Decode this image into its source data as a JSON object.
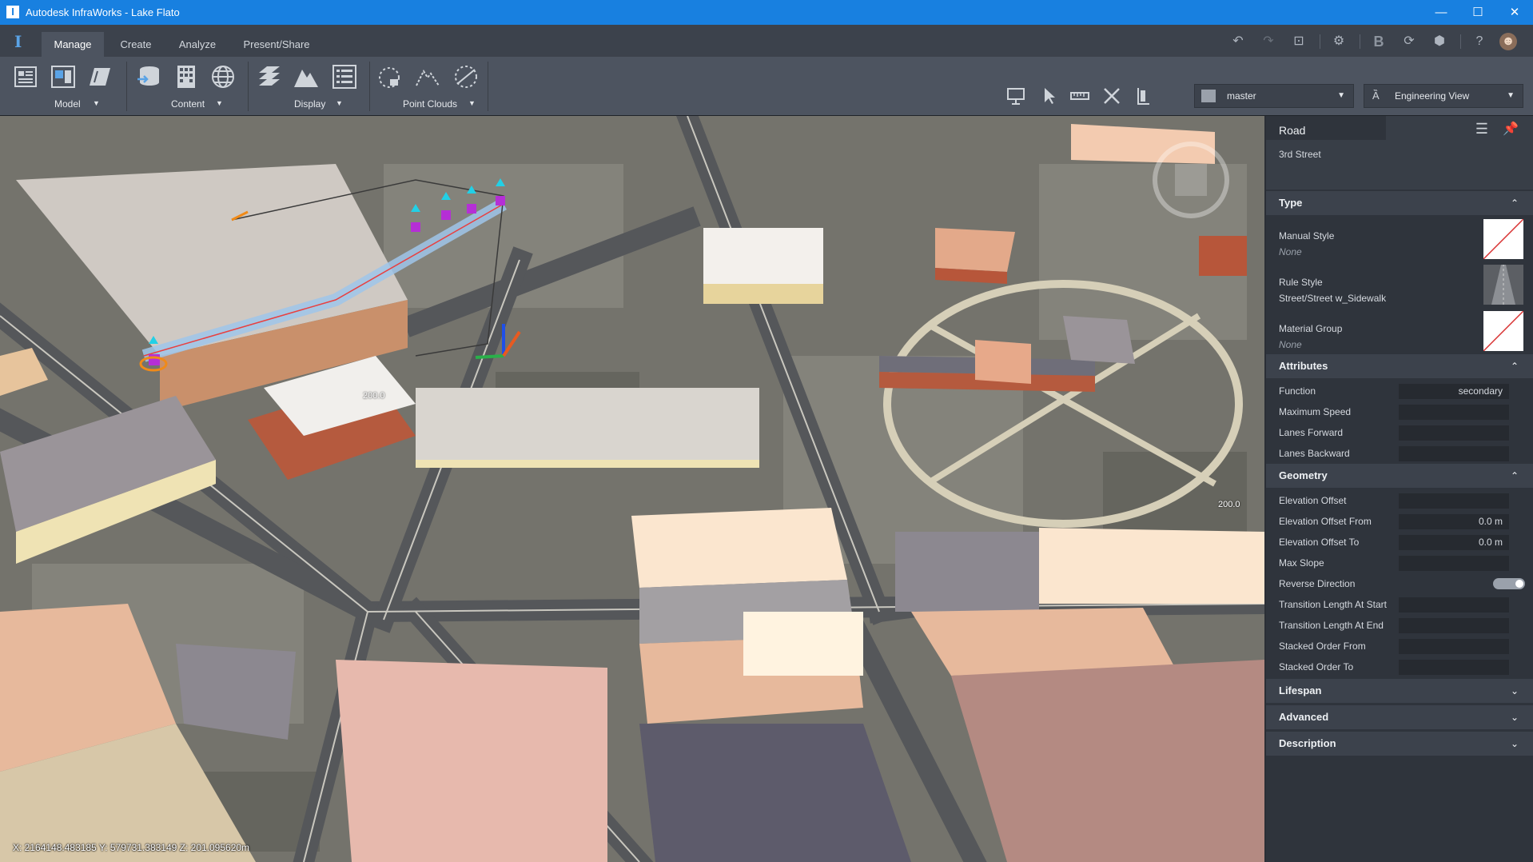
{
  "window": {
    "title": "Autodesk InfraWorks - Lake Flato",
    "app_icon": "I",
    "minimize": "—",
    "maximize": "☐",
    "close": "✕"
  },
  "tabs": [
    {
      "label": "Manage",
      "active": true
    },
    {
      "label": "Create",
      "active": false
    },
    {
      "label": "Analyze",
      "active": false
    },
    {
      "label": "Present/Share",
      "active": false
    }
  ],
  "ribbon": {
    "groups": [
      {
        "label": "Model",
        "caret": "▼"
      },
      {
        "label": "Content",
        "caret": "▼"
      },
      {
        "label": "Display",
        "caret": "▼"
      },
      {
        "label": "Point Clouds",
        "caret": "▼"
      }
    ],
    "proposal_dropdown": {
      "value": "master",
      "caret": "▼"
    },
    "view_dropdown": {
      "value": "Engineering View",
      "caret": "▼"
    }
  },
  "quick_access": {
    "account_label": "B"
  },
  "viewport": {
    "coords": "X: 2164148.483185 Y: 579731.383149 Z: 201.095620m",
    "dim_labels": [
      "200.0",
      "200.0"
    ]
  },
  "panel": {
    "type": "Road",
    "name": "3rd Street",
    "sections": {
      "type": {
        "title": "Type",
        "chevron": "⌃",
        "manual_style_label": "Manual Style",
        "manual_style_value": "None",
        "rule_style_label": "Rule Style",
        "rule_style_value": "Street/Street w_Sidewalk",
        "material_group_label": "Material Group",
        "material_group_value": "None"
      },
      "attributes": {
        "title": "Attributes",
        "chevron": "⌃",
        "rows": [
          {
            "label": "Function",
            "value": "secondary"
          },
          {
            "label": "Maximum Speed",
            "value": ""
          },
          {
            "label": "Lanes Forward",
            "value": ""
          },
          {
            "label": "Lanes Backward",
            "value": ""
          }
        ]
      },
      "geometry": {
        "title": "Geometry",
        "chevron": "⌃",
        "rows": [
          {
            "label": "Elevation Offset",
            "value": ""
          },
          {
            "label": "Elevation Offset From",
            "value": "0.0  m"
          },
          {
            "label": "Elevation Offset To",
            "value": "0.0  m"
          },
          {
            "label": "Max Slope",
            "value": ""
          },
          {
            "label": "Reverse Direction",
            "value": ""
          },
          {
            "label": "Transition Length At Start",
            "value": ""
          },
          {
            "label": "Transition Length At End",
            "value": ""
          },
          {
            "label": "Stacked Order From",
            "value": ""
          },
          {
            "label": "Stacked Order To",
            "value": ""
          }
        ]
      },
      "collapsed": [
        {
          "title": "Lifespan",
          "chevron": "⌄"
        },
        {
          "title": "Advanced",
          "chevron": "⌄"
        },
        {
          "title": "Description",
          "chevron": "⌄"
        }
      ]
    }
  },
  "colors": {
    "titlebar": "#1880e0",
    "tab_bar": "#3c424c",
    "ribbon": "#4d5460",
    "panel": "#2f343c",
    "accent": "#5aa3e6"
  }
}
